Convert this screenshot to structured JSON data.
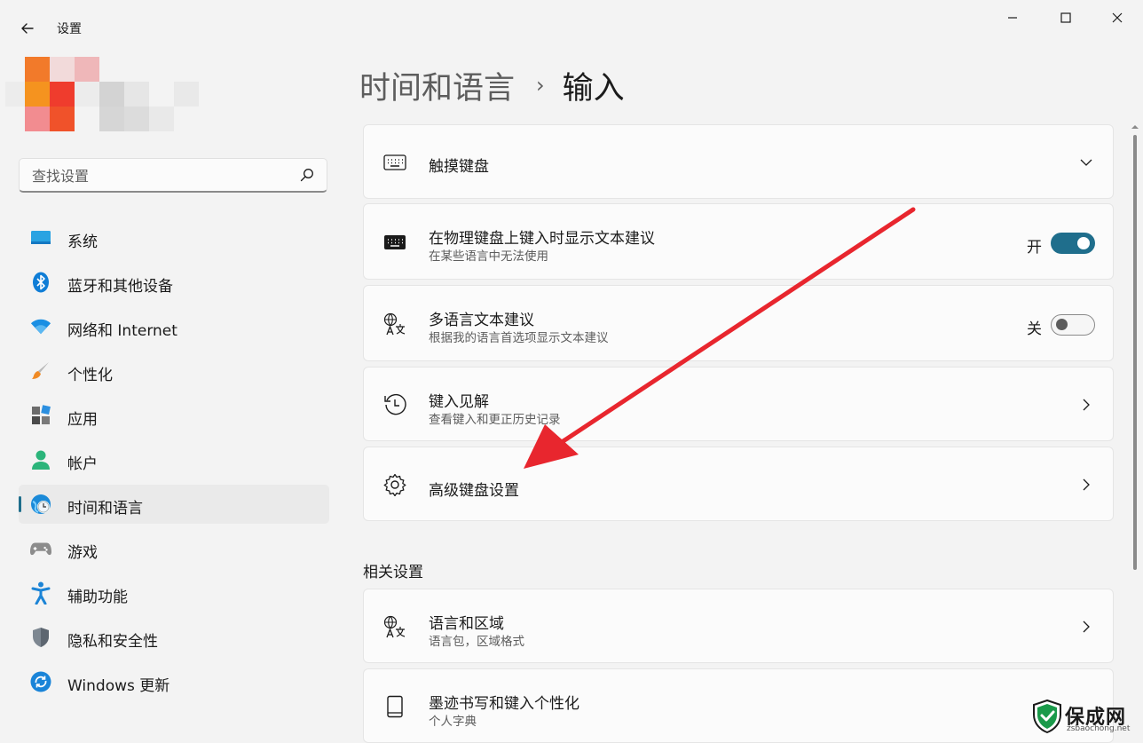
{
  "window": {
    "app_title": "设置"
  },
  "search": {
    "placeholder": "查找设置"
  },
  "sidebar": {
    "items": [
      {
        "label": "系统",
        "icon": "system-icon"
      },
      {
        "label": "蓝牙和其他设备",
        "icon": "bluetooth-icon"
      },
      {
        "label": "网络和 Internet",
        "icon": "wifi-icon"
      },
      {
        "label": "个性化",
        "icon": "brush-icon"
      },
      {
        "label": "应用",
        "icon": "apps-icon"
      },
      {
        "label": "帐户",
        "icon": "account-icon"
      },
      {
        "label": "时间和语言",
        "icon": "time-language-icon",
        "active": true
      },
      {
        "label": "游戏",
        "icon": "gamepad-icon"
      },
      {
        "label": "辅助功能",
        "icon": "accessibility-icon"
      },
      {
        "label": "隐私和安全性",
        "icon": "shield-icon"
      },
      {
        "label": "Windows 更新",
        "icon": "update-icon"
      }
    ]
  },
  "header": {
    "parent": "时间和语言",
    "separator": "›",
    "current": "输入"
  },
  "cards": {
    "touch_keyboard": {
      "title": "触摸键盘",
      "icon": "keyboard-icon"
    },
    "text_suggestions": {
      "title": "在物理键盘上键入时显示文本建议",
      "subtitle": "在某些语言中无法使用",
      "toggle_label": "开",
      "toggle_on": true,
      "icon": "keyboard-icon"
    },
    "multilingual": {
      "title": "多语言文本建议",
      "subtitle": "根据我的语言首选项显示文本建议",
      "toggle_label": "关",
      "toggle_on": false,
      "icon": "language-icon"
    },
    "typing_insights": {
      "title": "键入见解",
      "subtitle": "查看键入和更正历史记录",
      "icon": "history-icon"
    },
    "advanced_keyboard": {
      "title": "高级键盘设置",
      "icon": "gear-icon"
    }
  },
  "related": {
    "title": "相关设置",
    "language_region": {
      "title": "语言和区域",
      "subtitle": "语言包，区域格式",
      "icon": "language-icon"
    },
    "pen_ink": {
      "title": "墨迹书写和键入个性化",
      "subtitle": "个人字典",
      "icon": "notebook-icon"
    }
  },
  "watermark": {
    "brand": "保成网",
    "url": "zsbaochong.net"
  },
  "colors": {
    "accent": "#1f6e8c",
    "background": "#f3f3f3",
    "card": "#fbfbfb",
    "annotation_arrow": "#e8262e"
  }
}
